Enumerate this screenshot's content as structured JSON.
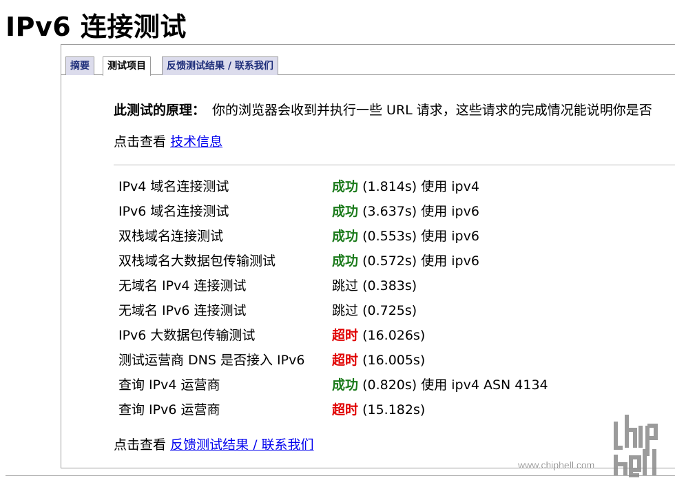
{
  "page": {
    "title": "IPv6 连接测试"
  },
  "tabs": [
    {
      "label": "摘要",
      "active": false
    },
    {
      "label": "测试项目",
      "active": true
    },
    {
      "label": "反馈测试结果 / 联系我们",
      "active": false
    }
  ],
  "principle": {
    "label": "此测试的原理：",
    "text": "你的浏览器会收到并执行一些 URL 请求，这些请求的完成情况能说明你是否"
  },
  "tech": {
    "prefix": "点击查看",
    "link": "技术信息"
  },
  "tests": [
    {
      "name": "IPv4 域名连接测试",
      "status": "成功",
      "detail": "(1.814s) 使用 ipv4"
    },
    {
      "name": "IPv6 域名连接测试",
      "status": "成功",
      "detail": "(3.637s) 使用 ipv6"
    },
    {
      "name": "双栈域名连接测试",
      "status": "成功",
      "detail": "(0.553s) 使用 ipv6"
    },
    {
      "name": "双栈域名大数据包传输测试",
      "status": "成功",
      "detail": "(0.572s) 使用 ipv6"
    },
    {
      "name": "无域名 IPv4 连接测试",
      "status": "跳过",
      "detail": "(0.383s)"
    },
    {
      "name": "无域名 IPv6 连接测试",
      "status": "跳过",
      "detail": "(0.725s)"
    },
    {
      "name": "IPv6 大数据包传输测试",
      "status": "超时",
      "detail": "(16.026s)"
    },
    {
      "name": "测试运营商 DNS 是否接入 IPv6",
      "status": "超时",
      "detail": "(16.005s)"
    },
    {
      "name": "查询 IPv4 运营商",
      "status": "成功",
      "detail": "(0.820s) 使用 ipv4 ASN 4134"
    },
    {
      "name": "查询 IPv6 运营商",
      "status": "超时",
      "detail": "(15.182s)"
    }
  ],
  "status_colors": {
    "成功": "#1a7a1a",
    "超时": "#e00000",
    "跳过": "#000000"
  },
  "feedback": {
    "prefix": "点击查看",
    "link": "反馈测试结果 / 联系我们"
  },
  "watermark": {
    "site": "www.chiphell.com",
    "logo_text": "chiphell"
  }
}
